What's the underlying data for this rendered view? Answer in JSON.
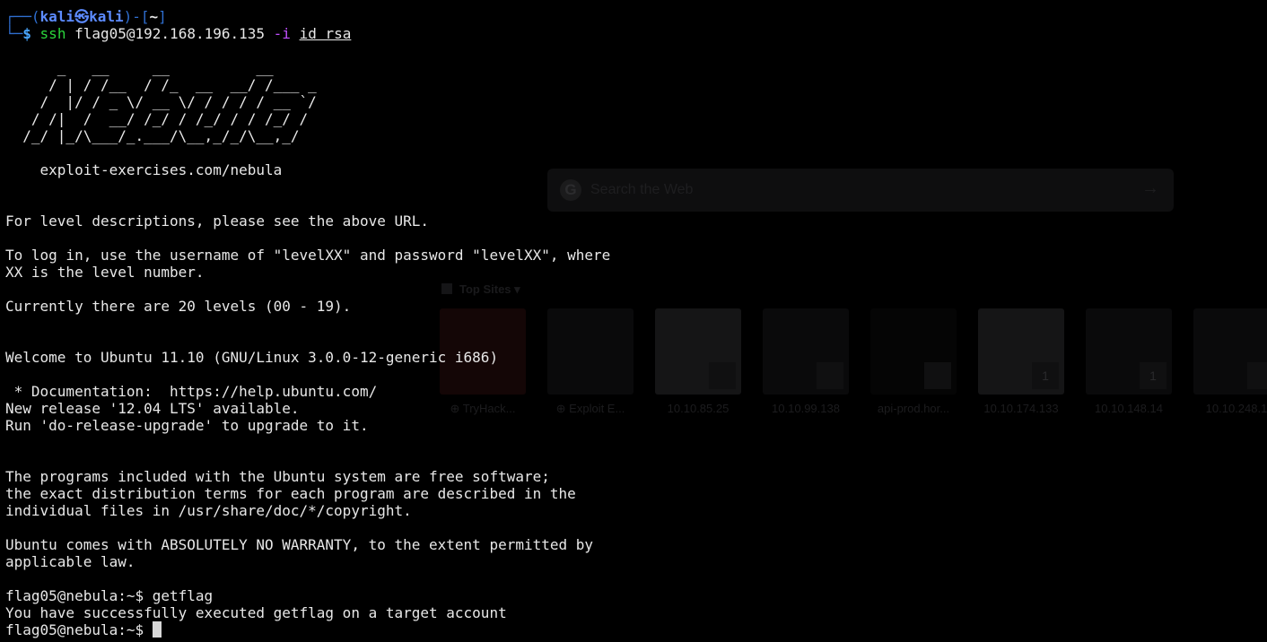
{
  "prompt": {
    "top_prefix": "┌──(",
    "user": "kali㉿kali",
    "mid": ")-[",
    "dir": "~",
    "end": "]",
    "bottom_prefix": "└─",
    "dollar": "$",
    "command": "ssh",
    "command_args": "flag05@192.168.196.135",
    "flag_option": "-i",
    "key_file": "id rsa"
  },
  "banner": [
    "      _   __     __          __",
    "     / | / /__  / /_  __  __/ /___ _",
    "    /  |/ / _ \\/ __ \\/ / / / / __ `/",
    "   / /|  /  __/ /_/ / /_/ / / /_/ /",
    "  /_/ |_/\\___/_.___/\\__,_/_/\\__,_/",
    "",
    "    exploit-exercises.com/nebula"
  ],
  "motd": [
    "For level descriptions, please see the above URL.",
    "",
    "To log in, use the username of \"levelXX\" and password \"levelXX\", where",
    "XX is the level number.",
    "",
    "Currently there are 20 levels (00 - 19).",
    "",
    "",
    "Welcome to Ubuntu 11.10 (GNU/Linux 3.0.0-12-generic i686)",
    "",
    " * Documentation:  https://help.ubuntu.com/",
    "New release '12.04 LTS' available.",
    "Run 'do-release-upgrade' to upgrade to it.",
    "",
    "",
    "The programs included with the Ubuntu system are free software;",
    "the exact distribution terms for each program are described in the",
    "individual files in /usr/share/doc/*/copyright.",
    "",
    "Ubuntu comes with ABSOLUTELY NO WARRANTY, to the extent permitted by",
    "applicable law.",
    "",
    "flag05@nebula:~$ getflag",
    "You have successfully executed getflag on a target account"
  ],
  "final_prompt": "flag05@nebula:~$ ",
  "browser": {
    "search_placeholder": "Search the Web",
    "top_sites_label": "Top Sites",
    "tiles": [
      "⊕ TryHack...",
      "⊕ Exploit E...",
      "10.10.85.25",
      "10.10.99.138",
      "api-prod.hor...",
      "10.10.174.133",
      "10.10.148.14",
      "10.10.248.1"
    ]
  },
  "colors": {
    "background": "#000000",
    "prompt_box": "#2f6fd1",
    "prompt_user": "#5c8bff",
    "command": "#2bd63c",
    "option": "#c050ff",
    "text": "#e8e8e8"
  }
}
